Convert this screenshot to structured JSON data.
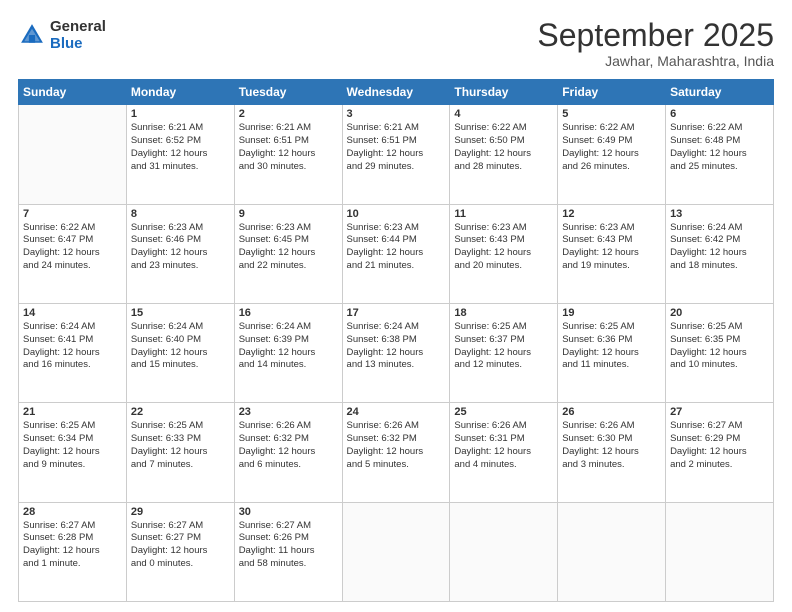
{
  "header": {
    "logo_general": "General",
    "logo_blue": "Blue",
    "month_title": "September 2025",
    "location": "Jawhar, Maharashtra, India"
  },
  "days_of_week": [
    "Sunday",
    "Monday",
    "Tuesday",
    "Wednesday",
    "Thursday",
    "Friday",
    "Saturday"
  ],
  "weeks": [
    [
      {
        "day": "",
        "info": ""
      },
      {
        "day": "1",
        "info": "Sunrise: 6:21 AM\nSunset: 6:52 PM\nDaylight: 12 hours\nand 31 minutes."
      },
      {
        "day": "2",
        "info": "Sunrise: 6:21 AM\nSunset: 6:51 PM\nDaylight: 12 hours\nand 30 minutes."
      },
      {
        "day": "3",
        "info": "Sunrise: 6:21 AM\nSunset: 6:51 PM\nDaylight: 12 hours\nand 29 minutes."
      },
      {
        "day": "4",
        "info": "Sunrise: 6:22 AM\nSunset: 6:50 PM\nDaylight: 12 hours\nand 28 minutes."
      },
      {
        "day": "5",
        "info": "Sunrise: 6:22 AM\nSunset: 6:49 PM\nDaylight: 12 hours\nand 26 minutes."
      },
      {
        "day": "6",
        "info": "Sunrise: 6:22 AM\nSunset: 6:48 PM\nDaylight: 12 hours\nand 25 minutes."
      }
    ],
    [
      {
        "day": "7",
        "info": "Sunrise: 6:22 AM\nSunset: 6:47 PM\nDaylight: 12 hours\nand 24 minutes."
      },
      {
        "day": "8",
        "info": "Sunrise: 6:23 AM\nSunset: 6:46 PM\nDaylight: 12 hours\nand 23 minutes."
      },
      {
        "day": "9",
        "info": "Sunrise: 6:23 AM\nSunset: 6:45 PM\nDaylight: 12 hours\nand 22 minutes."
      },
      {
        "day": "10",
        "info": "Sunrise: 6:23 AM\nSunset: 6:44 PM\nDaylight: 12 hours\nand 21 minutes."
      },
      {
        "day": "11",
        "info": "Sunrise: 6:23 AM\nSunset: 6:43 PM\nDaylight: 12 hours\nand 20 minutes."
      },
      {
        "day": "12",
        "info": "Sunrise: 6:23 AM\nSunset: 6:43 PM\nDaylight: 12 hours\nand 19 minutes."
      },
      {
        "day": "13",
        "info": "Sunrise: 6:24 AM\nSunset: 6:42 PM\nDaylight: 12 hours\nand 18 minutes."
      }
    ],
    [
      {
        "day": "14",
        "info": "Sunrise: 6:24 AM\nSunset: 6:41 PM\nDaylight: 12 hours\nand 16 minutes."
      },
      {
        "day": "15",
        "info": "Sunrise: 6:24 AM\nSunset: 6:40 PM\nDaylight: 12 hours\nand 15 minutes."
      },
      {
        "day": "16",
        "info": "Sunrise: 6:24 AM\nSunset: 6:39 PM\nDaylight: 12 hours\nand 14 minutes."
      },
      {
        "day": "17",
        "info": "Sunrise: 6:24 AM\nSunset: 6:38 PM\nDaylight: 12 hours\nand 13 minutes."
      },
      {
        "day": "18",
        "info": "Sunrise: 6:25 AM\nSunset: 6:37 PM\nDaylight: 12 hours\nand 12 minutes."
      },
      {
        "day": "19",
        "info": "Sunrise: 6:25 AM\nSunset: 6:36 PM\nDaylight: 12 hours\nand 11 minutes."
      },
      {
        "day": "20",
        "info": "Sunrise: 6:25 AM\nSunset: 6:35 PM\nDaylight: 12 hours\nand 10 minutes."
      }
    ],
    [
      {
        "day": "21",
        "info": "Sunrise: 6:25 AM\nSunset: 6:34 PM\nDaylight: 12 hours\nand 9 minutes."
      },
      {
        "day": "22",
        "info": "Sunrise: 6:25 AM\nSunset: 6:33 PM\nDaylight: 12 hours\nand 7 minutes."
      },
      {
        "day": "23",
        "info": "Sunrise: 6:26 AM\nSunset: 6:32 PM\nDaylight: 12 hours\nand 6 minutes."
      },
      {
        "day": "24",
        "info": "Sunrise: 6:26 AM\nSunset: 6:32 PM\nDaylight: 12 hours\nand 5 minutes."
      },
      {
        "day": "25",
        "info": "Sunrise: 6:26 AM\nSunset: 6:31 PM\nDaylight: 12 hours\nand 4 minutes."
      },
      {
        "day": "26",
        "info": "Sunrise: 6:26 AM\nSunset: 6:30 PM\nDaylight: 12 hours\nand 3 minutes."
      },
      {
        "day": "27",
        "info": "Sunrise: 6:27 AM\nSunset: 6:29 PM\nDaylight: 12 hours\nand 2 minutes."
      }
    ],
    [
      {
        "day": "28",
        "info": "Sunrise: 6:27 AM\nSunset: 6:28 PM\nDaylight: 12 hours\nand 1 minute."
      },
      {
        "day": "29",
        "info": "Sunrise: 6:27 AM\nSunset: 6:27 PM\nDaylight: 12 hours\nand 0 minutes."
      },
      {
        "day": "30",
        "info": "Sunrise: 6:27 AM\nSunset: 6:26 PM\nDaylight: 11 hours\nand 58 minutes."
      },
      {
        "day": "",
        "info": ""
      },
      {
        "day": "",
        "info": ""
      },
      {
        "day": "",
        "info": ""
      },
      {
        "day": "",
        "info": ""
      }
    ]
  ]
}
